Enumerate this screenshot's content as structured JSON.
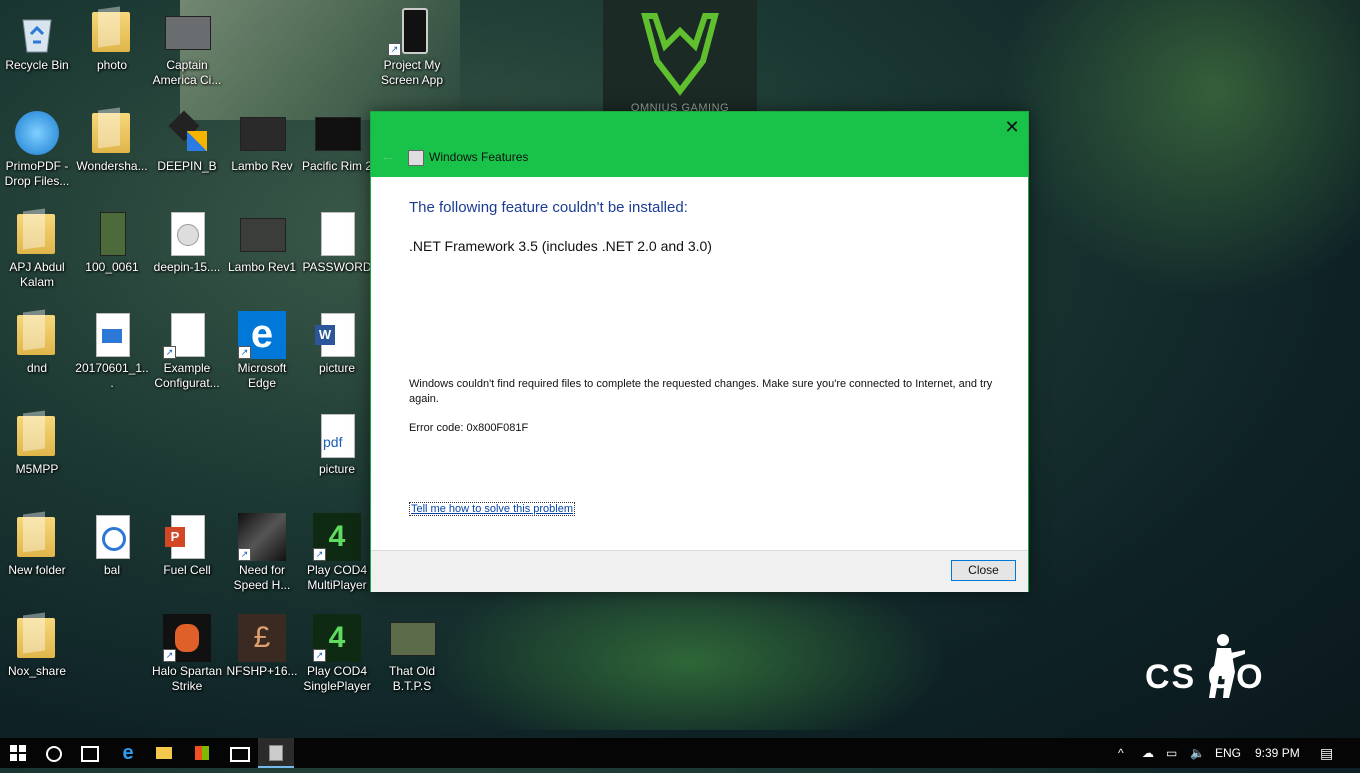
{
  "desktop": {
    "icons": [
      {
        "label": "Recycle Bin"
      },
      {
        "label": "photo"
      },
      {
        "label": "Captain America Ci..."
      },
      {
        "label": "Project My Screen App"
      },
      {
        "label": "PrimoPDF - Drop Files..."
      },
      {
        "label": "Wondersha..."
      },
      {
        "label": "DEEPIN_B"
      },
      {
        "label": "Lambo Rev"
      },
      {
        "label": "Pacific Rim 2"
      },
      {
        "label": "APJ Abdul Kalam"
      },
      {
        "label": "100_0061"
      },
      {
        "label": "deepin-15...."
      },
      {
        "label": "Lambo Rev1"
      },
      {
        "label": "PASSWORD"
      },
      {
        "label": "dnd"
      },
      {
        "label": "20170601_1..."
      },
      {
        "label": "Example Configurat..."
      },
      {
        "label": "Microsoft Edge"
      },
      {
        "label": "picture"
      },
      {
        "label": "M5MPP"
      },
      {
        "label": "picture"
      },
      {
        "label": "New folder"
      },
      {
        "label": "bal"
      },
      {
        "label": "Fuel Cell"
      },
      {
        "label": "Need for Speed H..."
      },
      {
        "label": "Play COD4 MultiPlayer"
      },
      {
        "label": "Nox_share"
      },
      {
        "label": "Halo Spartan Strike"
      },
      {
        "label": "NFSHP+16..."
      },
      {
        "label": "Play COD4 SinglePlayer"
      },
      {
        "label": "That Old B.T.P.S"
      }
    ]
  },
  "wallpaper": {
    "omnius_text": "OMNIUS GAMING",
    "csgo_text": "CS GO",
    "accent": "#5fbf2f"
  },
  "dialog": {
    "title": "Windows Features",
    "heading": "The following feature couldn't be installed:",
    "feature": ".NET Framework 3.5 (includes .NET 2.0 and 3.0)",
    "message": "Windows couldn't find required files to complete the requested changes. Make sure you're connected to Internet, and try again.",
    "error_code": "Error code: 0x800F081F",
    "help_link": "Tell me how to solve this problem",
    "close_label": "Close",
    "titlebar_color": "#19c34a",
    "heading_color": "#1c3c94"
  },
  "taskbar": {
    "items": [
      {
        "icon": "start-icon"
      },
      {
        "icon": "cortana-icon"
      },
      {
        "icon": "task-view-icon"
      },
      {
        "icon": "edge-icon"
      },
      {
        "icon": "file-explorer-icon"
      },
      {
        "icon": "store-icon"
      },
      {
        "icon": "mail-icon"
      },
      {
        "icon": "windows-features-icon"
      }
    ],
    "language": "ENG",
    "time": "9:39 PM"
  }
}
